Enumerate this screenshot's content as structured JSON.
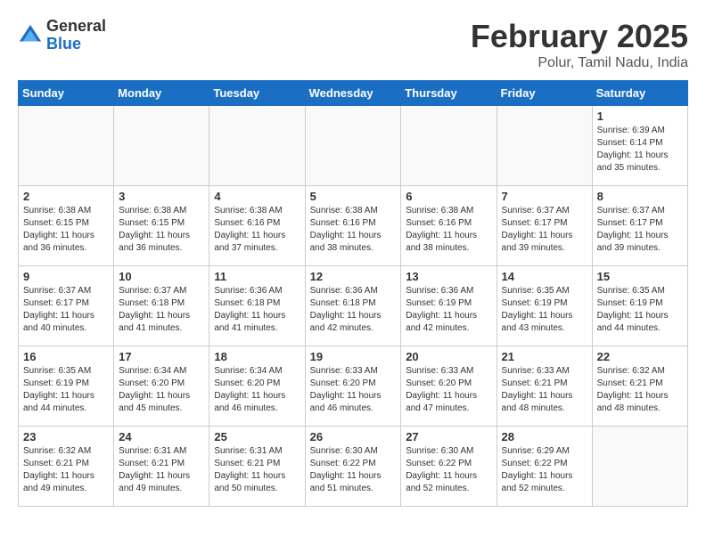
{
  "header": {
    "logo_general": "General",
    "logo_blue": "Blue",
    "month_year": "February 2025",
    "location": "Polur, Tamil Nadu, India"
  },
  "weekdays": [
    "Sunday",
    "Monday",
    "Tuesday",
    "Wednesday",
    "Thursday",
    "Friday",
    "Saturday"
  ],
  "weeks": [
    [
      {
        "day": "",
        "info": ""
      },
      {
        "day": "",
        "info": ""
      },
      {
        "day": "",
        "info": ""
      },
      {
        "day": "",
        "info": ""
      },
      {
        "day": "",
        "info": ""
      },
      {
        "day": "",
        "info": ""
      },
      {
        "day": "1",
        "info": "Sunrise: 6:39 AM\nSunset: 6:14 PM\nDaylight: 11 hours\nand 35 minutes."
      }
    ],
    [
      {
        "day": "2",
        "info": "Sunrise: 6:38 AM\nSunset: 6:15 PM\nDaylight: 11 hours\nand 36 minutes."
      },
      {
        "day": "3",
        "info": "Sunrise: 6:38 AM\nSunset: 6:15 PM\nDaylight: 11 hours\nand 36 minutes."
      },
      {
        "day": "4",
        "info": "Sunrise: 6:38 AM\nSunset: 6:16 PM\nDaylight: 11 hours\nand 37 minutes."
      },
      {
        "day": "5",
        "info": "Sunrise: 6:38 AM\nSunset: 6:16 PM\nDaylight: 11 hours\nand 38 minutes."
      },
      {
        "day": "6",
        "info": "Sunrise: 6:38 AM\nSunset: 6:16 PM\nDaylight: 11 hours\nand 38 minutes."
      },
      {
        "day": "7",
        "info": "Sunrise: 6:37 AM\nSunset: 6:17 PM\nDaylight: 11 hours\nand 39 minutes."
      },
      {
        "day": "8",
        "info": "Sunrise: 6:37 AM\nSunset: 6:17 PM\nDaylight: 11 hours\nand 39 minutes."
      }
    ],
    [
      {
        "day": "9",
        "info": "Sunrise: 6:37 AM\nSunset: 6:17 PM\nDaylight: 11 hours\nand 40 minutes."
      },
      {
        "day": "10",
        "info": "Sunrise: 6:37 AM\nSunset: 6:18 PM\nDaylight: 11 hours\nand 41 minutes."
      },
      {
        "day": "11",
        "info": "Sunrise: 6:36 AM\nSunset: 6:18 PM\nDaylight: 11 hours\nand 41 minutes."
      },
      {
        "day": "12",
        "info": "Sunrise: 6:36 AM\nSunset: 6:18 PM\nDaylight: 11 hours\nand 42 minutes."
      },
      {
        "day": "13",
        "info": "Sunrise: 6:36 AM\nSunset: 6:19 PM\nDaylight: 11 hours\nand 42 minutes."
      },
      {
        "day": "14",
        "info": "Sunrise: 6:35 AM\nSunset: 6:19 PM\nDaylight: 11 hours\nand 43 minutes."
      },
      {
        "day": "15",
        "info": "Sunrise: 6:35 AM\nSunset: 6:19 PM\nDaylight: 11 hours\nand 44 minutes."
      }
    ],
    [
      {
        "day": "16",
        "info": "Sunrise: 6:35 AM\nSunset: 6:19 PM\nDaylight: 11 hours\nand 44 minutes."
      },
      {
        "day": "17",
        "info": "Sunrise: 6:34 AM\nSunset: 6:20 PM\nDaylight: 11 hours\nand 45 minutes."
      },
      {
        "day": "18",
        "info": "Sunrise: 6:34 AM\nSunset: 6:20 PM\nDaylight: 11 hours\nand 46 minutes."
      },
      {
        "day": "19",
        "info": "Sunrise: 6:33 AM\nSunset: 6:20 PM\nDaylight: 11 hours\nand 46 minutes."
      },
      {
        "day": "20",
        "info": "Sunrise: 6:33 AM\nSunset: 6:20 PM\nDaylight: 11 hours\nand 47 minutes."
      },
      {
        "day": "21",
        "info": "Sunrise: 6:33 AM\nSunset: 6:21 PM\nDaylight: 11 hours\nand 48 minutes."
      },
      {
        "day": "22",
        "info": "Sunrise: 6:32 AM\nSunset: 6:21 PM\nDaylight: 11 hours\nand 48 minutes."
      }
    ],
    [
      {
        "day": "23",
        "info": "Sunrise: 6:32 AM\nSunset: 6:21 PM\nDaylight: 11 hours\nand 49 minutes."
      },
      {
        "day": "24",
        "info": "Sunrise: 6:31 AM\nSunset: 6:21 PM\nDaylight: 11 hours\nand 49 minutes."
      },
      {
        "day": "25",
        "info": "Sunrise: 6:31 AM\nSunset: 6:21 PM\nDaylight: 11 hours\nand 50 minutes."
      },
      {
        "day": "26",
        "info": "Sunrise: 6:30 AM\nSunset: 6:22 PM\nDaylight: 11 hours\nand 51 minutes."
      },
      {
        "day": "27",
        "info": "Sunrise: 6:30 AM\nSunset: 6:22 PM\nDaylight: 11 hours\nand 52 minutes."
      },
      {
        "day": "28",
        "info": "Sunrise: 6:29 AM\nSunset: 6:22 PM\nDaylight: 11 hours\nand 52 minutes."
      },
      {
        "day": "",
        "info": ""
      }
    ]
  ]
}
